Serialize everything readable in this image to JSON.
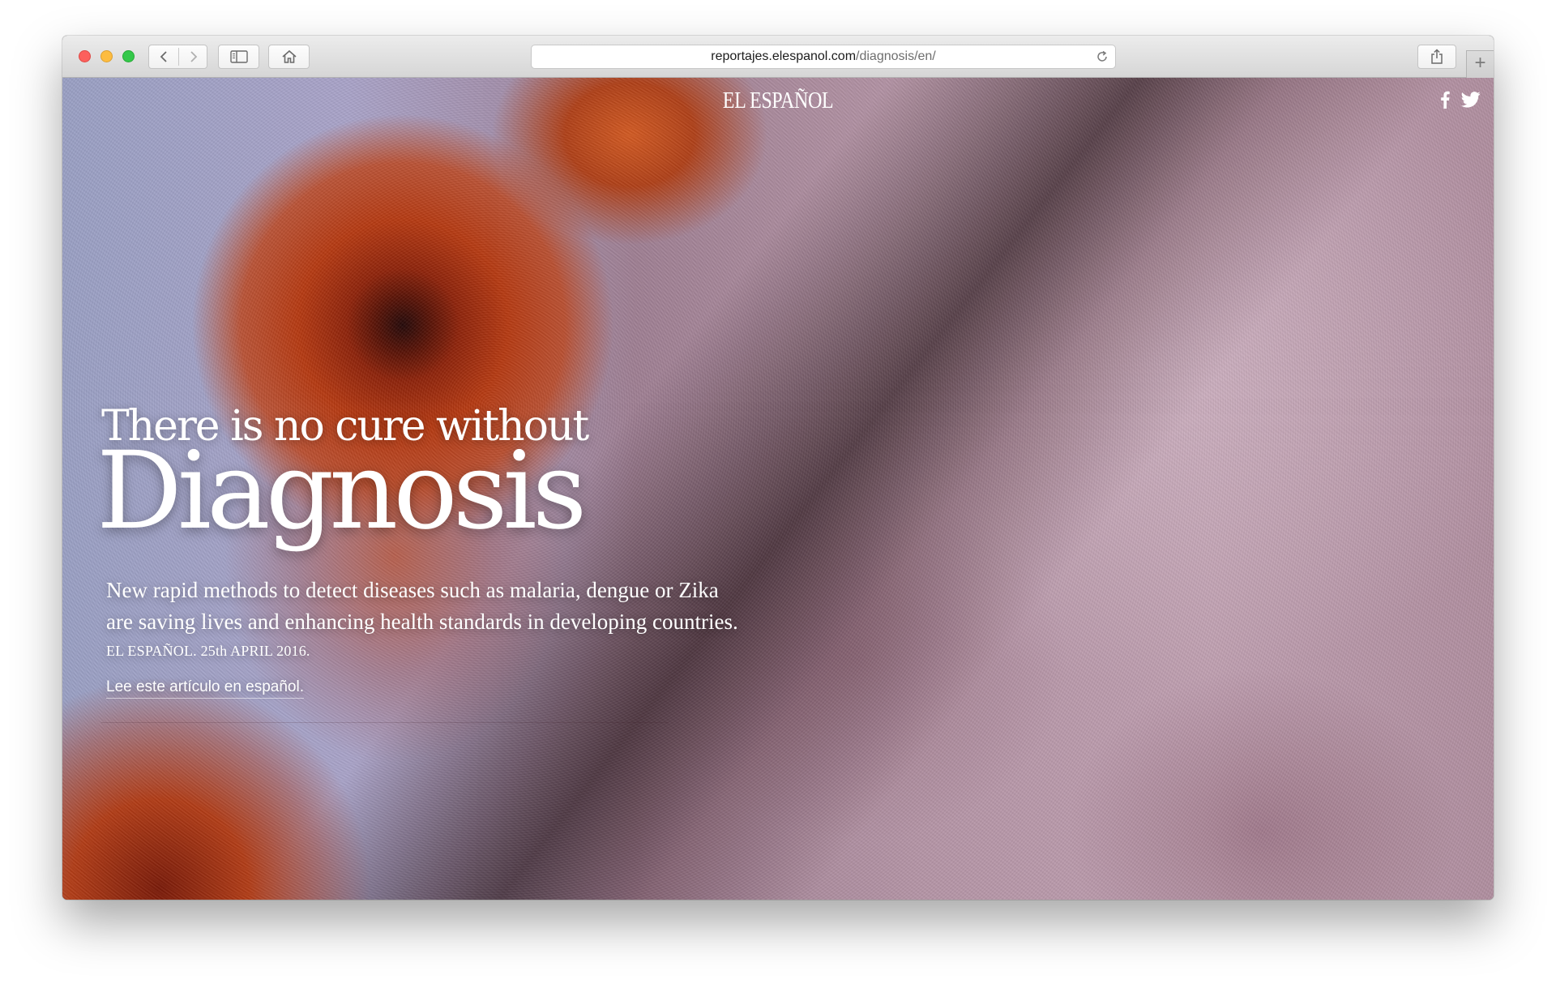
{
  "browser": {
    "url_host": "reportajes.elespanol.com",
    "url_path": "/diagnosis/en/",
    "new_tab_symbol": "+",
    "icons": [
      "chevron-left-icon",
      "chevron-right-icon",
      "sidebar-icon",
      "home-icon",
      "reload-icon",
      "share-icon",
      "plus-icon"
    ]
  },
  "site": {
    "logo": "EL ESPAÑOL",
    "social_icons": [
      "facebook-icon",
      "twitter-icon"
    ]
  },
  "hero": {
    "kicker": "There is no cure without",
    "headline": "Diagnosis",
    "dek_line1": "New rapid methods to detect diseases such as malaria, dengue or Zika",
    "dek_line2": "are saving lives and enhancing health standards in developing countries.",
    "byline": "EL ESPAÑOL. 25th APRIL 2016.",
    "lang_link": "Lee este artículo en español."
  },
  "colors": {
    "text": "#ffffff",
    "toolbar": "#dcdcdc",
    "close": "#fc605c",
    "minimize": "#fdbc40",
    "zoom": "#34c84a"
  }
}
